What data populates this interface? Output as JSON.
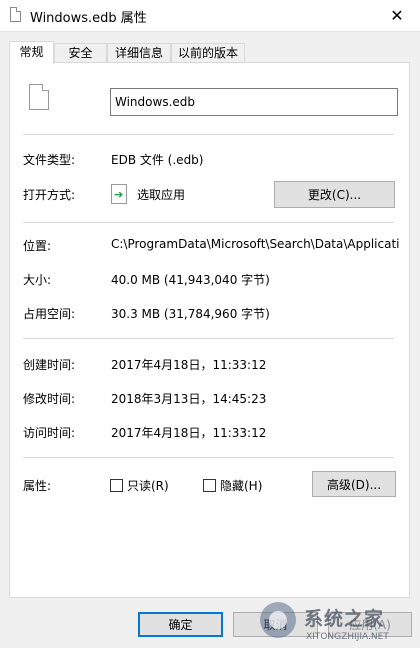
{
  "window": {
    "title": "Windows.edb 属性",
    "close_glyph": "✕"
  },
  "tabs": [
    {
      "label": "常规",
      "active": true
    },
    {
      "label": "安全",
      "active": false
    },
    {
      "label": "详细信息",
      "active": false
    },
    {
      "label": "以前的版本",
      "active": false
    }
  ],
  "general": {
    "filename": "Windows.edb",
    "file_type_label": "文件类型:",
    "file_type_value": "EDB 文件 (.edb)",
    "opens_with_label": "打开方式:",
    "opens_with_value": "选取应用",
    "change_button": "更改(C)...",
    "location_label": "位置:",
    "location_value": "C:\\ProgramData\\Microsoft\\Search\\Data\\Applicati",
    "size_label": "大小:",
    "size_value": "40.0 MB (41,943,040 字节)",
    "size_on_disk_label": "占用空间:",
    "size_on_disk_value": "30.3 MB (31,784,960 字节)",
    "created_label": "创建时间:",
    "created_value": "2017年4月18日，11:33:12",
    "modified_label": "修改时间:",
    "modified_value": "2018年3月13日，14:45:23",
    "accessed_label": "访问时间:",
    "accessed_value": "2017年4月18日，11:33:12",
    "attributes_label": "属性:",
    "readonly_label": "只读(R)",
    "readonly_checked": false,
    "hidden_label": "隐藏(H)",
    "hidden_checked": false,
    "advanced_button": "高级(D)..."
  },
  "footer": {
    "ok_button": "确定",
    "cancel_button": "取消",
    "apply_button": "应用(A)"
  },
  "watermark": {
    "text": "系统之家",
    "url": "XITONGZHIJIA.NET"
  },
  "colors": {
    "accent": "#0078d7",
    "window_bg": "#f0f0f0",
    "panel_bg": "#ffffff"
  }
}
